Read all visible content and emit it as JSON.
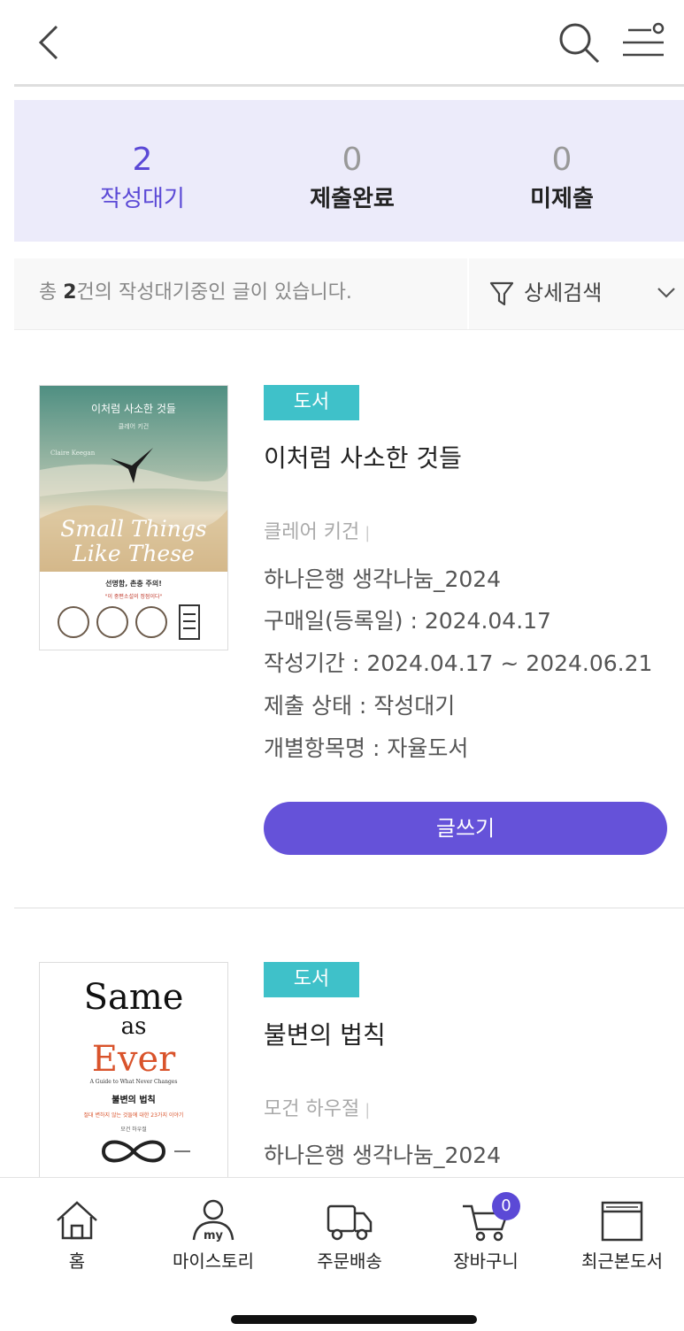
{
  "summary": [
    {
      "count": "2",
      "label": "작성대기",
      "active": true
    },
    {
      "count": "0",
      "label": "제출완료",
      "active": false
    },
    {
      "count": "0",
      "label": "미제출",
      "active": false
    }
  ],
  "filter": {
    "prefix": "총 ",
    "count": "2",
    "suffix": "건의 작성대기중인 글이 있습니다.",
    "detail_label": "상세검색"
  },
  "books": [
    {
      "tag": "도서",
      "title": "이처럼 사소한 것들",
      "author": "클레어 키건",
      "author_sep": "|",
      "program": "하나은행 생각나눔_2024",
      "purchase": "구매일(등록일) : 2024.04.17",
      "period": "작성기간 : 2024.04.17 ~ 2024.06.21",
      "status": "제출 상태 : 작성대기",
      "category": "개별항목명 : 자율도서",
      "button": "글쓰기",
      "cover": {
        "title_kr": "이처럼 사소한 것들",
        "author_kr": "클레어 키건",
        "author_en": "Claire Keegan",
        "title_en_1": "Small Things",
        "title_en_2": "Like These",
        "blurb": "선명함, 촌충 주의!",
        "quote": "\"이 중편소설의 정점이다\""
      }
    },
    {
      "tag": "도서",
      "title": "불변의 법칙",
      "author": "모건 하우절",
      "author_sep": "|",
      "program": "하나은행 생각나눔_2024",
      "cover": {
        "line1": "Same",
        "line2": "as",
        "line3": "Ever",
        "subtitle": "A Guide to What Never Changes",
        "title_kr": "불변의 법칙",
        "tagline": "절대 변하지 않는 것들에 대한 23가지 이야기",
        "author_kr": "모건 하우절"
      }
    }
  ],
  "tabbar": {
    "items": [
      {
        "label": "홈",
        "icon": "home-icon"
      },
      {
        "label": "마이스토리",
        "icon": "my-story-icon"
      },
      {
        "label": "주문배송",
        "icon": "delivery-truck-icon"
      },
      {
        "label": "장바구니",
        "icon": "cart-icon"
      },
      {
        "label": "최근본도서",
        "icon": "recent-books-icon"
      }
    ],
    "cart_count": "0"
  },
  "colors": {
    "accent": "#5b49d6",
    "button": "#6552d9",
    "tag": "#3fc1c9",
    "summary_bg": "#ecebfa"
  }
}
